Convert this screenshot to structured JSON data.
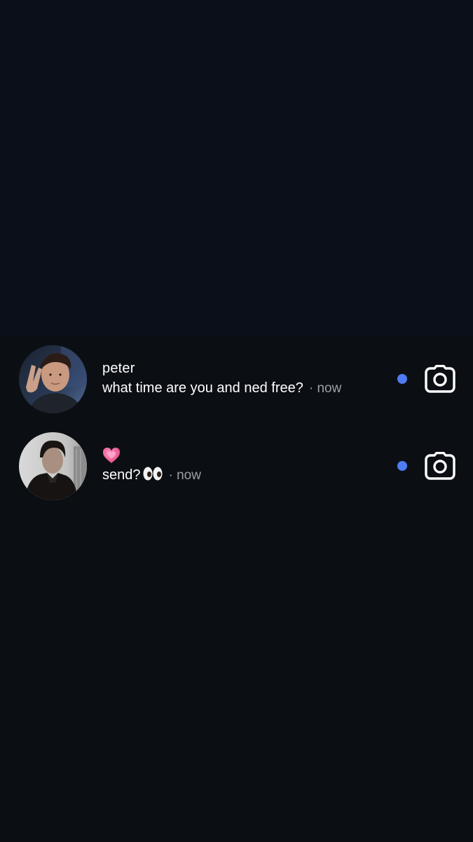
{
  "threads": [
    {
      "name": "peter",
      "message": "what time are you and ned free?",
      "time": "· now",
      "unread": true,
      "avatar": "profile-photo",
      "action_icon": "camera-icon"
    },
    {
      "name": "💗",
      "message": "send?",
      "message_emoji": "👀",
      "time": "· now",
      "unread": true,
      "avatar": "profile-photo",
      "action_icon": "camera-icon"
    }
  ],
  "colors": {
    "background": "#0b0f14",
    "unread_dot": "#4f7bf3",
    "secondary_text": "#9aa0a8",
    "heart": "#e8508f"
  }
}
